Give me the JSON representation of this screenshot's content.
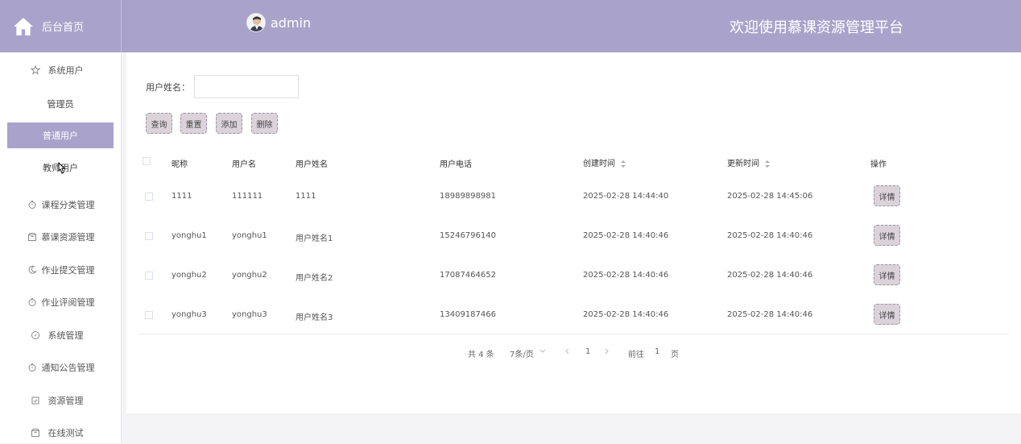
{
  "header": {
    "brand": "后台首页",
    "username": "admin",
    "welcome": "欢迎使用慕课资源管理平台"
  },
  "sidebar": {
    "items": [
      {
        "label": "系统用户",
        "icon": "star-icon"
      },
      {
        "label": "课程分类管理",
        "icon": "timer-icon"
      },
      {
        "label": "慕课资源管理",
        "icon": "box-icon"
      },
      {
        "label": "作业提交管理",
        "icon": "moon-icon"
      },
      {
        "label": "作业评阅管理",
        "icon": "timer-icon"
      },
      {
        "label": "系统管理",
        "icon": "compass-icon"
      },
      {
        "label": "通知公告管理",
        "icon": "timer-icon"
      },
      {
        "label": "资源管理",
        "icon": "tray-icon"
      },
      {
        "label": "在线测试",
        "icon": "box-icon"
      }
    ],
    "subitems": [
      {
        "label": "管理员"
      },
      {
        "label": "普通用户"
      },
      {
        "label": "教师用户"
      }
    ]
  },
  "search": {
    "label": "用户姓名：",
    "value": "",
    "placeholder": ""
  },
  "toolbar": {
    "query": "查询",
    "reset": "重置",
    "add": "添加",
    "delete": "删除"
  },
  "table": {
    "headers": [
      "昵称",
      "用户名",
      "用户姓名",
      "用户电话",
      "创建时间",
      "更新时间",
      "操作"
    ],
    "rows": [
      {
        "nickname": "1111",
        "username": "111111",
        "realname": "1111",
        "phone": "18989898981",
        "created": "2025-02-28 14:44:40",
        "updated": "2025-02-28 14:45:06",
        "action": "详情"
      },
      {
        "nickname": "yonghu1",
        "username": "yonghu1",
        "realname": "用户姓名1",
        "phone": "15246796140",
        "created": "2025-02-28 14:40:46",
        "updated": "2025-02-28 14:40:46",
        "action": "详情"
      },
      {
        "nickname": "yonghu2",
        "username": "yonghu2",
        "realname": "用户姓名2",
        "phone": "17087464652",
        "created": "2025-02-28 14:40:46",
        "updated": "2025-02-28 14:40:46",
        "action": "详情"
      },
      {
        "nickname": "yonghu3",
        "username": "yonghu3",
        "realname": "用户姓名3",
        "phone": "13409187466",
        "created": "2025-02-28 14:40:46",
        "updated": "2025-02-28 14:40:46",
        "action": "详情"
      }
    ]
  },
  "pagination": {
    "total": "共 4 条",
    "page_size": "7条/页",
    "current_page": "1",
    "goto_label": "前往",
    "goto_value": "1",
    "page_suffix": "页"
  },
  "colors": {
    "accent": "#a9a3cb",
    "button_bg": "#dcd3da",
    "active_page": "#409eff"
  }
}
